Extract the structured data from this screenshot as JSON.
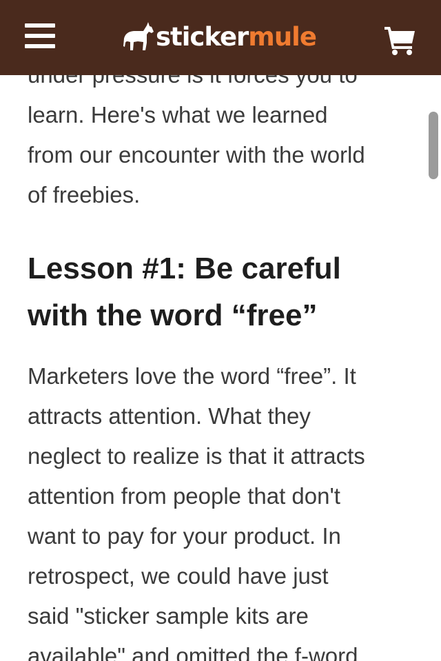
{
  "header": {
    "menu_icon": "hamburger-menu-icon",
    "logo": {
      "icon": "mule-icon",
      "word_sticker": "sticker",
      "word_mule": "mule"
    },
    "cart_icon": "shopping-cart-icon",
    "background": "#4a2a1d",
    "accent": "#f07b30"
  },
  "article": {
    "intro_lines": "under pressure is it forces you to\nlearn. Here's what we learned\nfrom our encounter with the world\nof freebies.",
    "heading": "Lesson #1: Be careful\nwith the word “free”",
    "body_lines": "Marketers love the word “free”. It\nattracts attention. What they\nneglect to realize is that it attracts\nattention from people that don't\nwant to pay for your product. In\nretrospect, we could have just\nsaid \"sticker sample kits are\navailable\" and omitted the f-word"
  }
}
